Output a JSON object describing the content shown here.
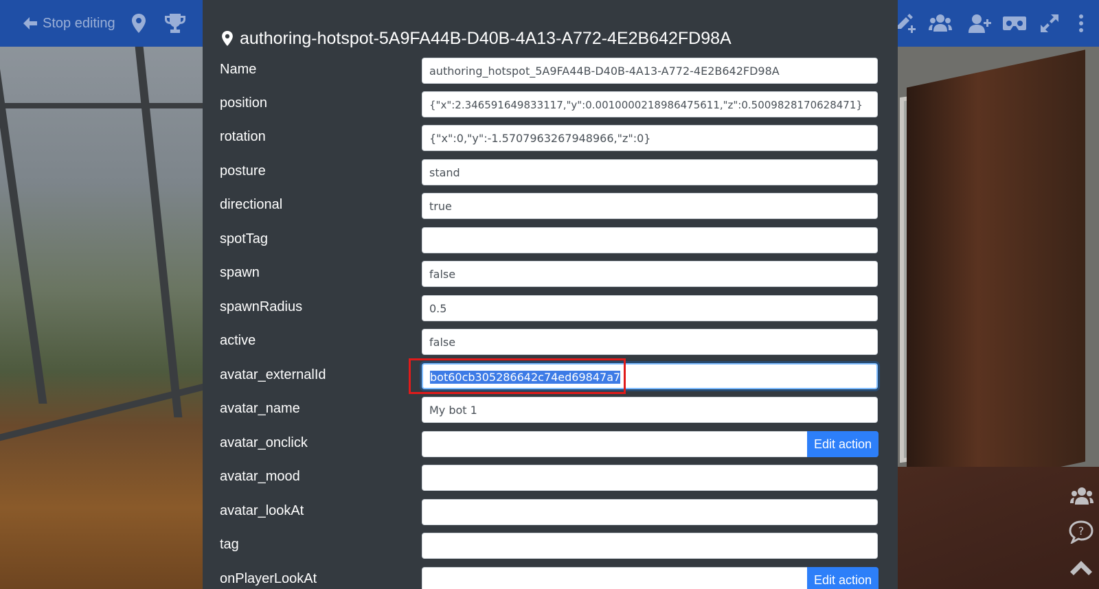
{
  "topbar": {
    "stop_editing": "Stop editing",
    "left_icons": [
      "arrow-left-icon",
      "map-marker-icon",
      "trophy-icon"
    ],
    "right_icons": [
      "pencil-plus-icon",
      "users-icon",
      "user-plus-icon",
      "vr-headset-icon",
      "expand-icon",
      "more-vertical-icon"
    ]
  },
  "dialog": {
    "title": "authoring-hotspot-5A9FA44B-D40B-4A13-A772-4E2B642FD98A",
    "fields": [
      {
        "label": "Name",
        "value": "authoring_hotspot_5A9FA44B-D40B-4A13-A772-4E2B642FD98A"
      },
      {
        "label": "position",
        "value": "{\"x\":2.346591649833117,\"y\":0.0010000218986475611,\"z\":0.5009828170628471}"
      },
      {
        "label": "rotation",
        "value": "{\"x\":0,\"y\":-1.5707963267948966,\"z\":0}"
      },
      {
        "label": "posture",
        "value": "stand"
      },
      {
        "label": "directional",
        "value": "true"
      },
      {
        "label": "spotTag",
        "value": ""
      },
      {
        "label": "spawn",
        "value": "false"
      },
      {
        "label": "spawnRadius",
        "value": "0.5"
      },
      {
        "label": "active",
        "value": "false"
      },
      {
        "label": "avatar_externalId",
        "value": "bot60cb305286642c74ed69847a7"
      },
      {
        "label": "avatar_name",
        "value": "My bot 1"
      },
      {
        "label": "avatar_onclick",
        "value": "",
        "button": "Edit action"
      },
      {
        "label": "avatar_mood",
        "value": ""
      },
      {
        "label": "avatar_lookAt",
        "value": ""
      },
      {
        "label": "tag",
        "value": ""
      },
      {
        "label": "onPlayerLookAt",
        "value": "",
        "button": "Edit action"
      }
    ]
  },
  "side_icons": [
    "users-icon",
    "help-chat-icon",
    "chevron-up-icon"
  ],
  "colors": {
    "topbar": "#1f4fa6",
    "dialog": "#343a40",
    "button": "#2d7ff9",
    "highlight": "#e01b1b"
  }
}
